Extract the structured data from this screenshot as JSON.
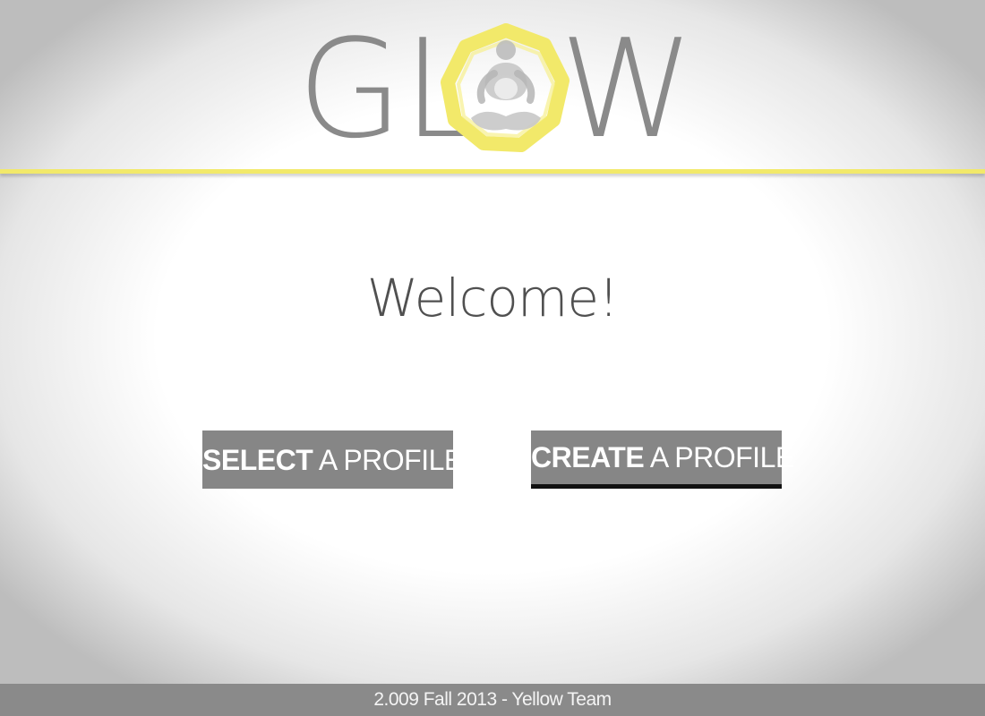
{
  "header": {
    "logo": {
      "text_left": "GL",
      "text_right": "W",
      "emblem_icon": "hexagon-meditation-icon",
      "emblem_color": "#f2e96a",
      "text_color": "#8a8a8a"
    },
    "accent_color": "#f2e96a"
  },
  "main": {
    "welcome": "Welcome!",
    "buttons": {
      "select": {
        "strong": "SELECT",
        "rest": " A PROFILE"
      },
      "create": {
        "strong": "CREATE",
        "rest": " A PROFILE"
      }
    },
    "button_color": "#868686"
  },
  "footer": {
    "text": "2.009 Fall 2013 - Yellow Team"
  }
}
